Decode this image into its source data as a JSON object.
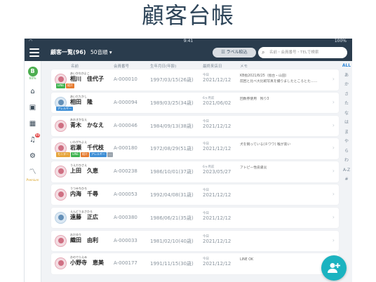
{
  "page": {
    "title": "顧客台帳"
  },
  "status": {
    "time": "9:41",
    "battery": "100%"
  },
  "topbar": {
    "title": "顧客一覧(96)",
    "filter": "50音順 ▾",
    "label_button": "ラベル絞込",
    "search_placeholder": "名前・会員番号・TELで検索"
  },
  "sidebar": {
    "logo": "B",
    "percent": "60%",
    "badge": "99",
    "premium": "Premium"
  },
  "columns": {
    "name": "名前",
    "number": "会員番号",
    "dob": "生年月日(年齢)",
    "last_visit": "最終来店日",
    "memo": "メモ"
  },
  "alphabet": [
    "ALL",
    "あ",
    "か",
    "さ",
    "た",
    "な",
    "は",
    "ま",
    "や",
    "ら",
    "わ",
    "A-Z",
    "#"
  ],
  "customers": [
    {
      "kana": "あいかわかよこ",
      "name": "相川　佳代子",
      "number": "A-000010",
      "dob": "1997/03/15(26歳)",
      "ago": "今日",
      "date": "2021/12/12",
      "memo1": "KB指2021/8/25（指台・山田）",
      "memo2": "前回と比べ大比較写真を撮りましたところとた……",
      "tags": [
        {
          "text": "LINE",
          "color": "#3fb34f"
        },
        {
          "text": "紹介",
          "color": "#e67b2f"
        }
      ],
      "female": true
    },
    {
      "kana": "あいだたかし",
      "name": "相田　隆",
      "number": "A-000094",
      "dob": "1989/03/25(34歳)",
      "ago": "6ヶ月前",
      "date": "2021/06/02",
      "memo1": "回数券使用　残り3",
      "memo2": "",
      "tags": [
        {
          "text": "アレルギー",
          "color": "#3f8fd6"
        }
      ],
      "female": false
    },
    {
      "kana": "あおきかなえ",
      "name": "青木　かなえ",
      "number": "A-000046",
      "dob": "1984/09/13(38歳)",
      "ago": "今日",
      "date": "2021/12/12",
      "memo1": "",
      "memo2": "",
      "tags": [],
      "female": true
    },
    {
      "kana": "いわがちよえ",
      "name": "岩瀬　千代枝",
      "number": "A-000180",
      "dob": "1972/08/29(51歳)",
      "ago": "今日",
      "date": "2021/12/12",
      "memo1": "犬を飼っている(チワワ) 喉が高い",
      "memo2": "",
      "tags": [
        {
          "text": "モニター",
          "color": "#e6a43a"
        },
        {
          "text": "LINE",
          "color": "#3fb34f"
        },
        {
          "text": "紹介",
          "color": "#e67b2f"
        },
        {
          "text": "アレルギー",
          "color": "#3f8fd6"
        },
        {
          "text": "…",
          "color": "#9ba5ae"
        }
      ],
      "female": true
    },
    {
      "kana": "うえだひさえ",
      "name": "上田　久恵",
      "number": "A-000238",
      "dob": "1986/10/01(37歳)",
      "ago": "6ヶ月前",
      "date": "2023/05/27",
      "memo1": "アトピー性皮膚炎",
      "memo2": "",
      "tags": [],
      "female": true
    },
    {
      "kana": "うつみちひろ",
      "name": "内海　千尋",
      "number": "A-000053",
      "dob": "1992/04/08(31歳)",
      "ago": "今日",
      "date": "2021/12/12",
      "memo1": "",
      "memo2": "",
      "tags": [],
      "female": true
    },
    {
      "kana": "えんどうまさひろ",
      "name": "遠藤　正広",
      "number": "A-000380",
      "dob": "1986/06/21(35歳)",
      "ago": "今日",
      "date": "2021/12/12",
      "memo1": "",
      "memo2": "",
      "tags": [],
      "female": false
    },
    {
      "kana": "おだゆり",
      "name": "織田　由利",
      "number": "A-000033",
      "dob": "1981/02/10(40歳)",
      "ago": "今日",
      "date": "2021/12/12",
      "memo1": "",
      "memo2": "",
      "tags": [],
      "female": true
    },
    {
      "kana": "おのでらえみ",
      "name": "小野寺　恵美",
      "number": "A-000177",
      "dob": "1991/11/15(30歳)",
      "ago": "今日",
      "date": "2021/12/12",
      "memo1": "LINE OK",
      "memo2": "",
      "tags": [],
      "female": true
    }
  ]
}
